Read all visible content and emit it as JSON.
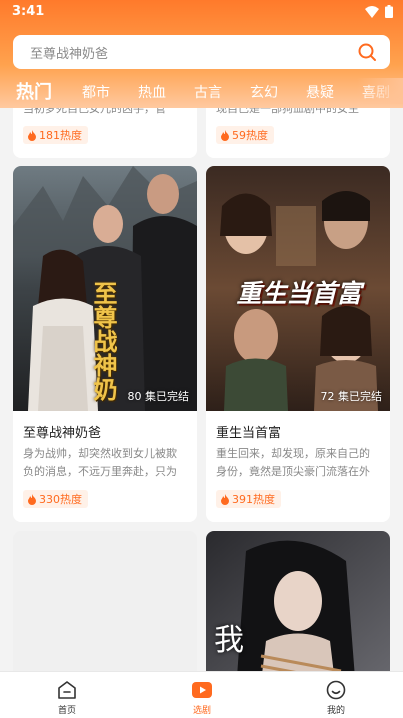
{
  "status": {
    "time": "3:41"
  },
  "search": {
    "placeholder": "至尊战神奶爸"
  },
  "tabs": [
    "热门",
    "都市",
    "热血",
    "古言",
    "玄幻",
    "悬疑",
    "喜剧"
  ],
  "cards": [
    {
      "title": "",
      "desc": "当初梦死自己女儿的凶手，管女…",
      "heat": "181热度"
    },
    {
      "title": "",
      "desc": "现自己是一部狗血剧中的女主角…",
      "heat": "59热度"
    },
    {
      "title": "至尊战神奶爸",
      "desc": "身为战帅，却突然收到女儿被欺负的消息，不远万里奔赴，只为护…",
      "heat": "330热度",
      "episodes": "80 集已完结",
      "poster_text": "至尊战神奶爸"
    },
    {
      "title": "重生当首富",
      "desc": "重生回来，却发现，原来自己的身份，竟然是顶尖豪门流落在外的…",
      "heat": "391热度",
      "episodes": "72 集已完结",
      "poster_text": "重生当首富"
    },
    {
      "title": "",
      "desc": "",
      "heat": "",
      "poster_text": "我"
    }
  ],
  "nav": [
    {
      "label": "首页",
      "icon": "home-icon"
    },
    {
      "label": "选剧",
      "icon": "play-icon"
    },
    {
      "label": "我的",
      "icon": "smile-icon"
    }
  ],
  "colors": {
    "accent": "#ff6a1f",
    "header_top": "#ff7a2b"
  }
}
